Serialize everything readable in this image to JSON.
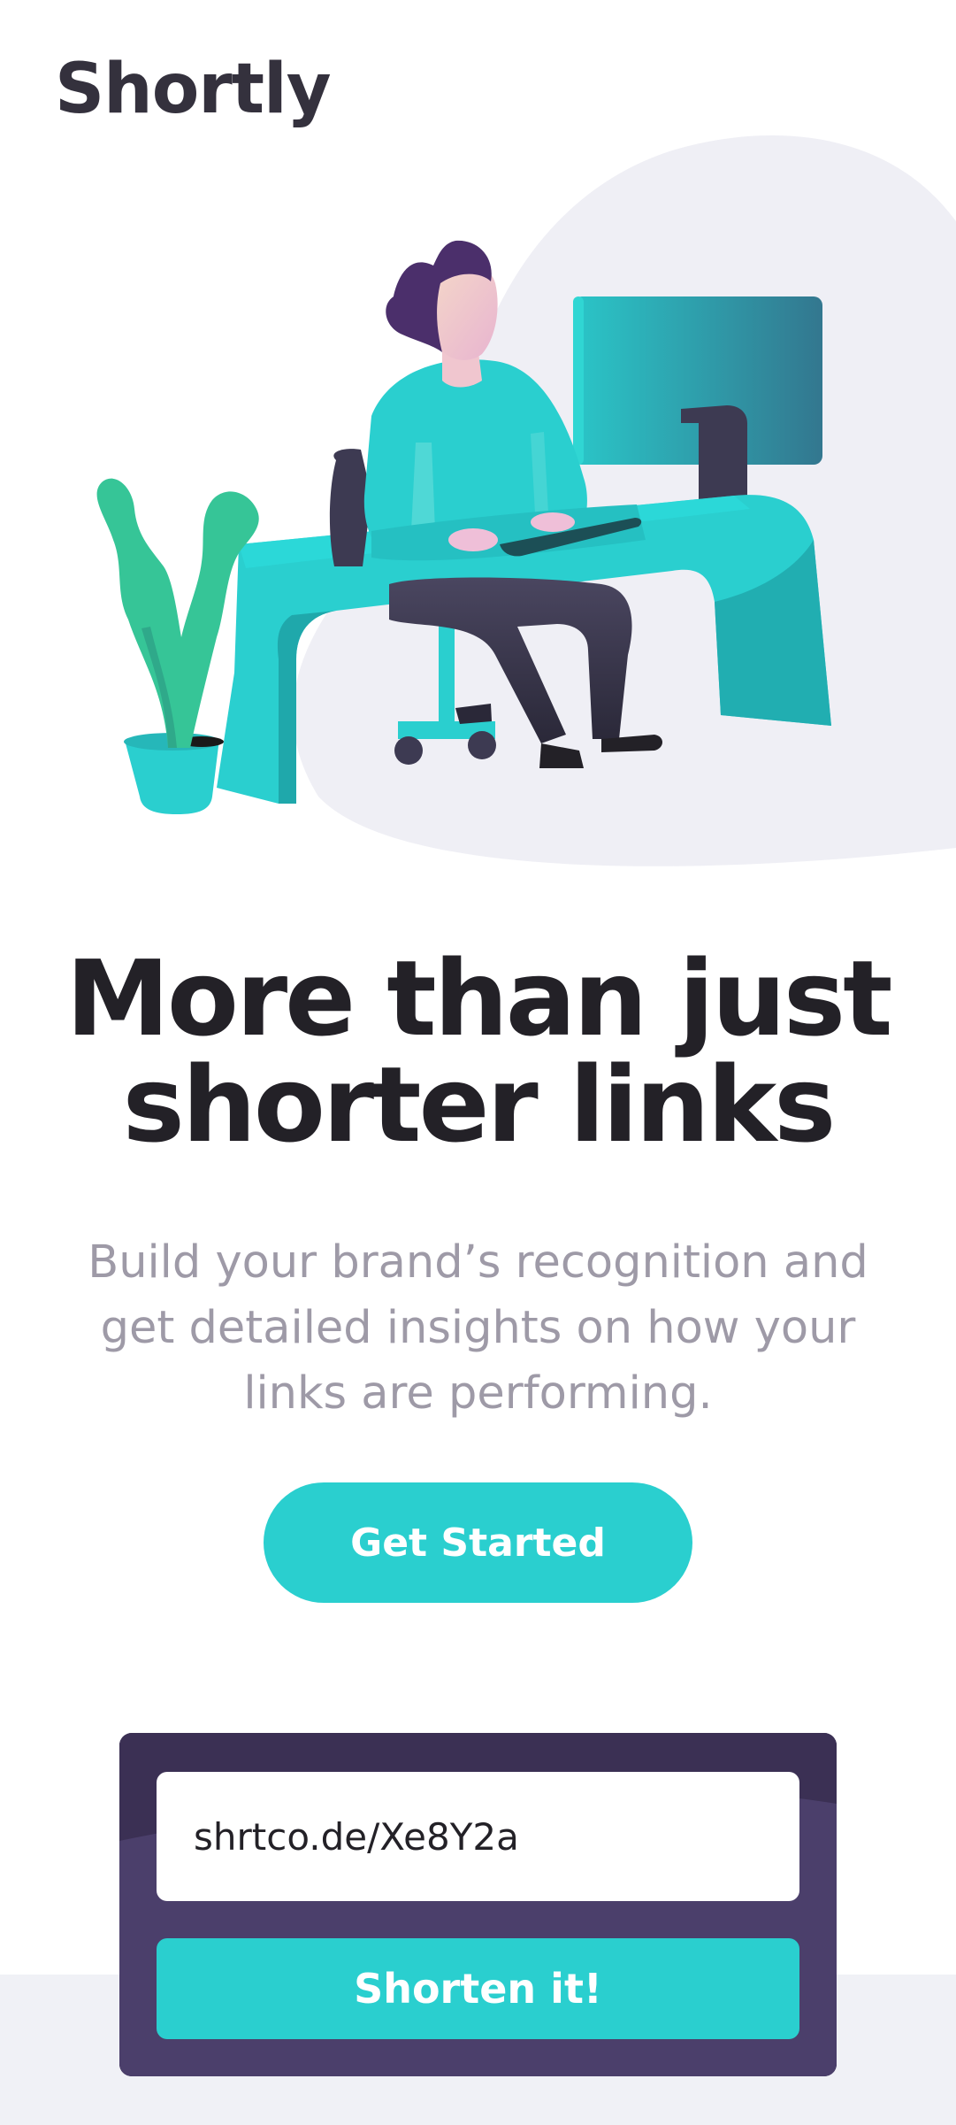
{
  "brand": {
    "logo": "Shortly"
  },
  "hero": {
    "headline": "More than just shorter links",
    "subtext": "Build your brand’s recognition and get detailed insights on how your links are performing.",
    "cta_label": "Get Started"
  },
  "shorten": {
    "input_value": "shrtco.de/Xe8Y2a",
    "button_label": "Shorten it!"
  },
  "colors": {
    "primary_cyan": "#2acfcf",
    "dark_violet": "#3b3054",
    "very_dark_text": "#232127",
    "grayish_violet": "#9e9aa7",
    "light_gray_bg": "#f0f1f6"
  }
}
